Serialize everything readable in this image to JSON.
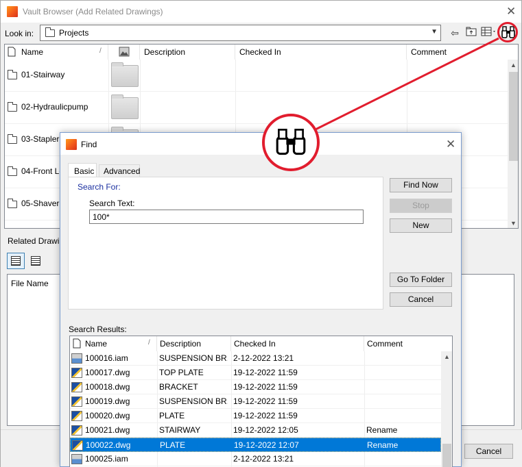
{
  "vault_browser": {
    "title": "Vault Browser (Add Related Drawings)",
    "lookin_label": "Look in:",
    "lookin_value": "Projects",
    "columns": {
      "name": "Name",
      "description": "Description",
      "checked_in": "Checked In",
      "comment": "Comment"
    },
    "rows": [
      "01-Stairway",
      "02-Hydraulicpump",
      "03-Stapler",
      "04-Front Lo",
      "05-Shaver"
    ],
    "related_label": "Related Drawing",
    "file_name_header": "File Name",
    "cancel_label": "Cancel"
  },
  "find": {
    "title": "Find",
    "tabs": {
      "basic": "Basic",
      "advanced": "Advanced"
    },
    "search_for": "Search For:",
    "search_text_label": "Search Text:",
    "search_text_value": "100*",
    "buttons": {
      "find_now": "Find Now",
      "stop": "Stop",
      "new": "New",
      "go_to_folder": "Go To Folder",
      "cancel": "Cancel"
    },
    "results_label": "Search Results:",
    "columns": {
      "name": "Name",
      "description": "Description",
      "checked_in": "Checked In",
      "comment": "Comment"
    },
    "results": [
      {
        "name": "100016.iam",
        "description": "SUSPENSION BR...",
        "checked_in": "2-12-2022 13:21",
        "comment": "",
        "type": "iam"
      },
      {
        "name": "100017.dwg",
        "description": "TOP PLATE",
        "checked_in": "19-12-2022 11:59",
        "comment": "",
        "type": "dwg"
      },
      {
        "name": "100018.dwg",
        "description": "BRACKET",
        "checked_in": "19-12-2022 11:59",
        "comment": "",
        "type": "dwg"
      },
      {
        "name": "100019.dwg",
        "description": "SUSPENSION BR...",
        "checked_in": "19-12-2022 11:59",
        "comment": "",
        "type": "dwg"
      },
      {
        "name": "100020.dwg",
        "description": "PLATE",
        "checked_in": "19-12-2022 11:59",
        "comment": "",
        "type": "dwg"
      },
      {
        "name": "100021.dwg",
        "description": "STAIRWAY",
        "checked_in": "19-12-2022 12:05",
        "comment": "Rename",
        "type": "dwg"
      },
      {
        "name": "100022.dwg",
        "description": "PLATE",
        "checked_in": "19-12-2022 12:07",
        "comment": "Rename",
        "type": "dwg",
        "selected": true
      },
      {
        "name": "100025.iam",
        "description": "",
        "checked_in": "2-12-2022 13:21",
        "comment": "",
        "type": "iam"
      }
    ]
  },
  "colors": {
    "callout": "#e11d2e",
    "selection": "#0078d7",
    "search_for": "#1a2fa0"
  },
  "icons": {
    "find": "binoculars-icon",
    "back": "arrow-left-icon",
    "up_folder": "folder-up-icon",
    "views": "view-menu-icon"
  }
}
